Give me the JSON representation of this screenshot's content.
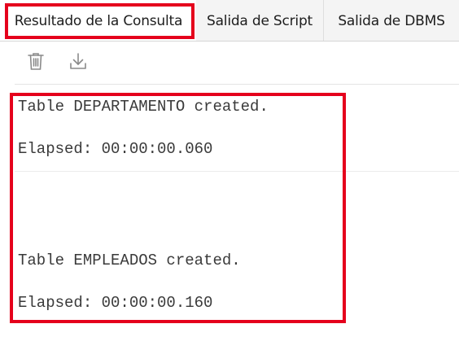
{
  "tabs": [
    {
      "label": "Resultado de la Consulta",
      "active": true
    },
    {
      "label": "Salida de Script",
      "active": false
    },
    {
      "label": "Salida de DBMS",
      "active": false
    }
  ],
  "toolbar": {
    "buttons": [
      {
        "icon": "trash-icon"
      },
      {
        "icon": "download-icon"
      }
    ]
  },
  "output": {
    "lines": [
      "Table DEPARTAMENTO created.",
      "Elapsed: 00:00:00.060",
      "Table EMPLEADOS created.",
      "Elapsed: 00:00:00.160"
    ]
  },
  "colors": {
    "highlight": "#e5001c",
    "text": "#3a3a3a"
  }
}
